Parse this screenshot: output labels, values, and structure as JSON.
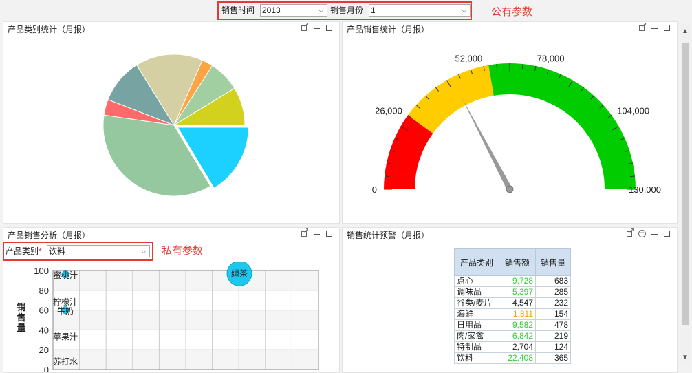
{
  "public_params": {
    "time_label": "销售时间",
    "time_value": "2013",
    "month_label": "销售月份",
    "month_value": "1",
    "annotation": "公有参数"
  },
  "panel_pie": {
    "title": "产品类别统计（月报）"
  },
  "panel_gauge": {
    "title": "产品销售统计（月报）",
    "ticks": [
      "0",
      "26,000",
      "52,000",
      "78,000",
      "104,000",
      "130,000"
    ],
    "gauge_data": {
      "min": 0,
      "max": 130000,
      "value": 45000,
      "red_to": 26000,
      "yellow_to": 58000,
      "colors": {
        "red": "#ff0000",
        "yellow": "#ffcc00",
        "green": "#00cc00"
      }
    }
  },
  "panel_analysis": {
    "title": "产品销售分析（月报）",
    "category_label": "产品类别",
    "required_mark": "*",
    "category_value": "饮料",
    "annotation": "私有参数",
    "ylabel": "销售量"
  },
  "panel_alert": {
    "title": "销售统计预警（月报）",
    "headers": [
      "产品类别",
      "销售额",
      "销售量"
    ],
    "rows": [
      {
        "name": "点心",
        "amount": "9,728",
        "qty": "683",
        "color": "#33cc33"
      },
      {
        "name": "调味品",
        "amount": "5,397",
        "qty": "285",
        "color": "#33cc33"
      },
      {
        "name": "谷类/麦片",
        "amount": "4,547",
        "qty": "232",
        "color": "#222222"
      },
      {
        "name": "海鲜",
        "amount": "1,811",
        "qty": "154",
        "color": "#ff9900"
      },
      {
        "name": "日用品",
        "amount": "9,582",
        "qty": "478",
        "color": "#33cc33"
      },
      {
        "name": "肉/家禽",
        "amount": "6,842",
        "qty": "219",
        "color": "#33cc33"
      },
      {
        "name": "特制品",
        "amount": "2,704",
        "qty": "124",
        "color": "#222222"
      },
      {
        "name": "饮料",
        "amount": "22,408",
        "qty": "365",
        "color": "#33cc33"
      }
    ]
  },
  "chart_data": [
    {
      "type": "pie",
      "values": [
        16,
        35,
        3.5,
        10,
        15,
        2.5,
        7,
        8.5
      ],
      "colors": [
        "#1cd0ff",
        "#96c8a0",
        "#ff6b6b",
        "#77a3a3",
        "#d4d0a4",
        "#ffa444",
        "#a2cfa2",
        "#d2d21e"
      ],
      "exploded_index": 0
    },
    {
      "type": "scatter",
      "ylabel": "销售量",
      "ylim": [
        0,
        100
      ],
      "yticks": [
        0,
        20,
        40,
        60,
        80,
        100
      ],
      "category_labels": [
        "蜜桃汁",
        "柠檬汁",
        "牛奶",
        "苹果汁",
        "苏打水"
      ],
      "category_label_y": [
        95,
        68,
        59,
        33,
        8
      ],
      "bubbles": [
        {
          "label": "绿茶",
          "y": 97,
          "color": "#1cc8f0"
        },
        {
          "label": "",
          "y": 96,
          "color": "#1cc8f0"
        },
        {
          "label": "",
          "y": 60,
          "color": "#1cc8f0"
        }
      ]
    }
  ]
}
